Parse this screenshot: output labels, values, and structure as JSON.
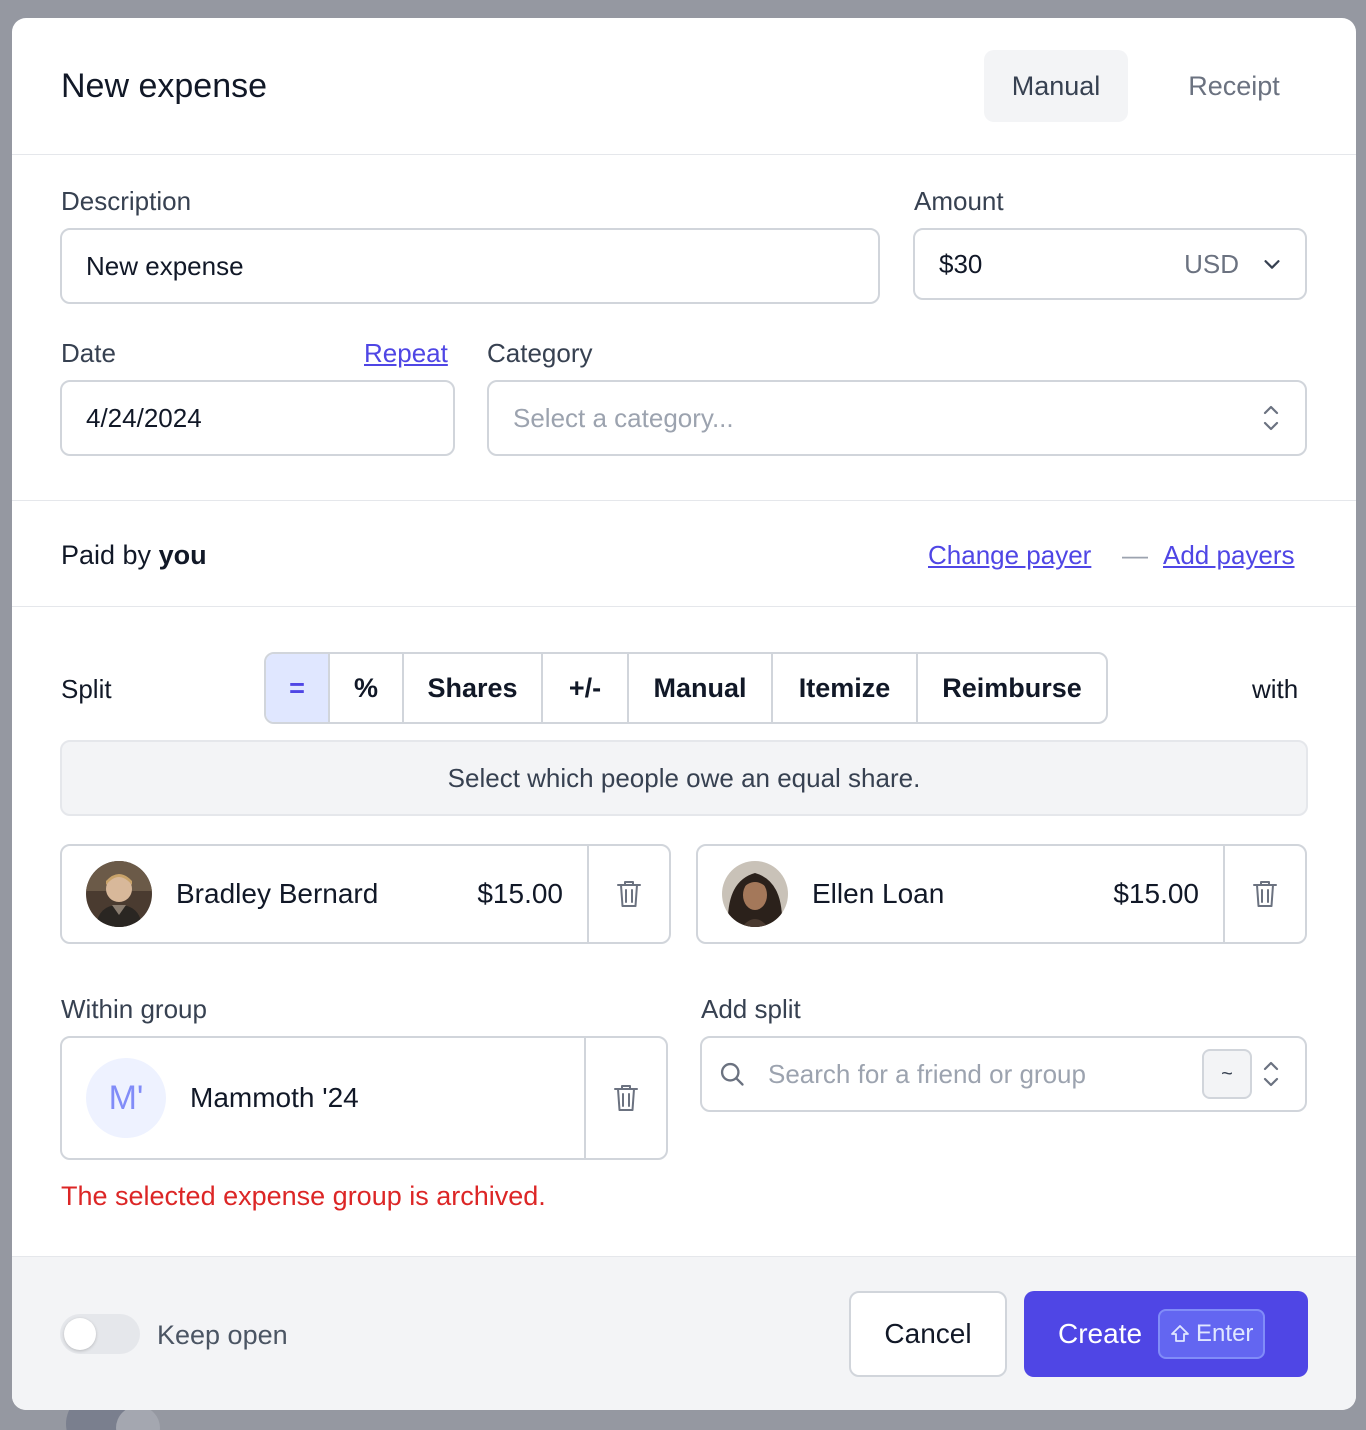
{
  "modal": {
    "title": "New expense",
    "tabs": [
      {
        "label": "Manual",
        "active": true
      },
      {
        "label": "Receipt",
        "active": false
      }
    ]
  },
  "form": {
    "description": {
      "label": "Description",
      "value": "New expense"
    },
    "amount": {
      "label": "Amount",
      "value": "$30",
      "currency": "USD"
    },
    "date": {
      "label": "Date",
      "value": "4/24/2024",
      "repeat_link": "Repeat"
    },
    "category": {
      "label": "Category",
      "placeholder": "Select a category..."
    }
  },
  "payer": {
    "prefix": "Paid by",
    "who": "you",
    "change_link": "Change payer",
    "separator": "—",
    "add_link": "Add payers"
  },
  "split": {
    "label": "Split",
    "with_label": "with",
    "methods": [
      {
        "label": "=",
        "active": true
      },
      {
        "label": "%",
        "active": false
      },
      {
        "label": "Shares",
        "active": false
      },
      {
        "label": "+/-",
        "active": false
      },
      {
        "label": "Manual",
        "active": false
      },
      {
        "label": "Itemize",
        "active": false
      },
      {
        "label": "Reimburse",
        "active": false
      }
    ],
    "info": "Select which people owe an equal share.",
    "people": [
      {
        "name": "Bradley Bernard",
        "amount": "$15.00"
      },
      {
        "name": "Ellen Loan",
        "amount": "$15.00"
      }
    ]
  },
  "group": {
    "label": "Within group",
    "initials": "M'",
    "name": "Mammoth '24",
    "error": "The selected expense group is archived."
  },
  "add_split": {
    "label": "Add split",
    "placeholder": "Search for a friend or group",
    "shortcut": "~"
  },
  "footer": {
    "keep_open_label": "Keep open",
    "keep_open": false,
    "cancel_label": "Cancel",
    "create_label": "Create",
    "create_shortcut": "Enter"
  },
  "colors": {
    "accent": "#4f46e5",
    "error": "#dc2626",
    "backdrop": "#9598a1"
  }
}
